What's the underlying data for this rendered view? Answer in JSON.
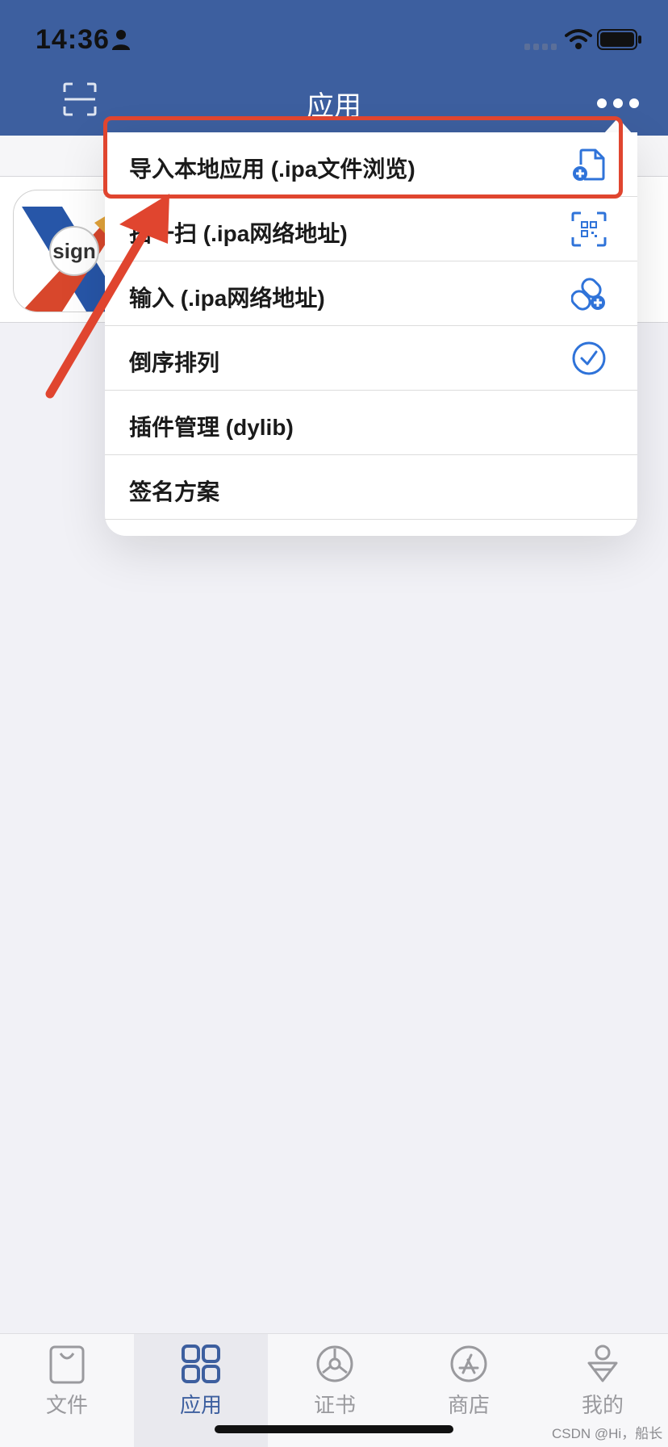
{
  "status_bar": {
    "time": "14:36"
  },
  "header": {
    "title": "应用"
  },
  "menu": {
    "items": [
      {
        "label": "导入本地应用 (.ipa文件浏览)",
        "icon": "file-add-icon"
      },
      {
        "label": "扫一扫 (.ipa网络地址)",
        "icon": "qr-scan-icon"
      },
      {
        "label": "输入 (.ipa网络地址)",
        "icon": "link-add-icon"
      },
      {
        "label": "倒序排列",
        "icon": "check-circle-icon"
      },
      {
        "label": "插件管理 (dylib)",
        "icon": ""
      },
      {
        "label": "签名方案",
        "icon": ""
      }
    ]
  },
  "app": {
    "icon_text": "sign"
  },
  "tabs": [
    {
      "label": "文件",
      "icon": "bag-icon",
      "active": false
    },
    {
      "label": "应用",
      "icon": "grid-icon",
      "active": true
    },
    {
      "label": "证书",
      "icon": "certificate-icon",
      "active": false
    },
    {
      "label": "商店",
      "icon": "app-store-icon",
      "active": false
    },
    {
      "label": "我的",
      "icon": "profile-icon",
      "active": false
    }
  ],
  "watermark": "CSDN @Hi，船长",
  "colors": {
    "header": "#3d5f9f",
    "accent_icon": "#2f73d9",
    "highlight": "#e0452f",
    "tab_inactive": "#9a9a9e"
  }
}
